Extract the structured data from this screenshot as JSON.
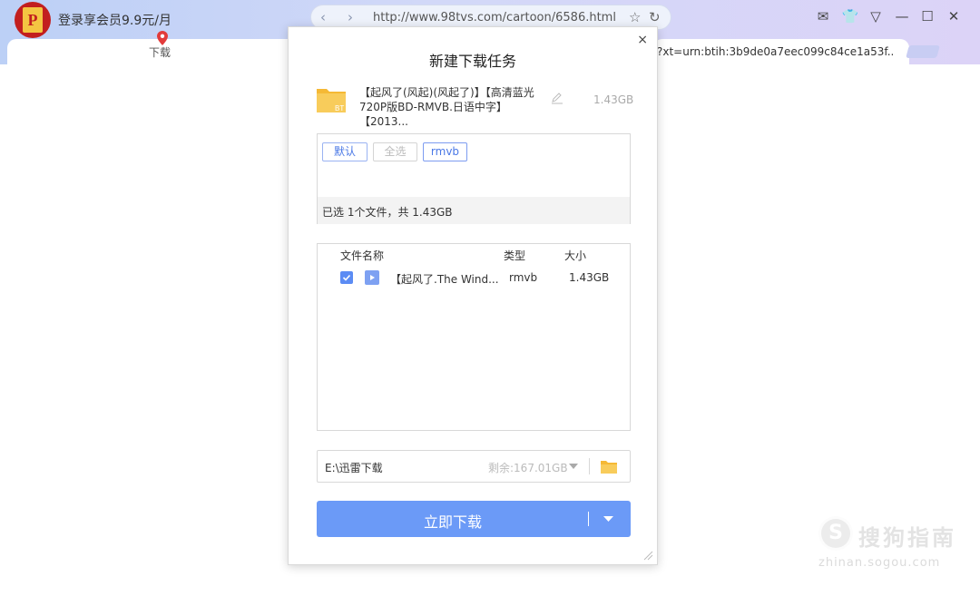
{
  "browser": {
    "vip_promo": "登录享会员9.9元/月",
    "tab_left_label": "下载",
    "url": "http://www.98tvs.com/cartoon/6586.html",
    "tab_right_label": "?xt=urn:btih:3b9de0a7eec099c84ce1a53f...",
    "nav_back": "‹",
    "nav_forward": "›",
    "star": "☆",
    "reload": "↻",
    "win_mail": "✉",
    "win_skin": "👕",
    "win_menu": "▽",
    "win_min": "—",
    "win_max": "☐",
    "win_close": "✕"
  },
  "dialog": {
    "title": "新建下载任务",
    "close": "×",
    "task_name": "【起风了(风起)(风起了)】【高清蓝光720P版BD-RMVB.日语中字】【2013...",
    "task_size": "1.43GB",
    "folder_badge": "BT",
    "filters": {
      "default": "默认",
      "select_all": "全选",
      "rmvb": "rmvb"
    },
    "selection_summary": "已选 1个文件，共 1.43GB",
    "table": {
      "headers": [
        "文件名称",
        "类型",
        "大小"
      ],
      "rows": [
        {
          "name": "【起风了.The Wind...",
          "type": "rmvb",
          "size": "1.43GB",
          "checked": true
        }
      ]
    },
    "save_path": "E:\\迅雷下载",
    "free_space": "剩余:167.01GB",
    "download_button": "立即下载"
  },
  "watermark": {
    "logo_letter": "S",
    "text": "搜狗指南",
    "url": "zhinan.sogou.com"
  },
  "colors": {
    "accent": "#6b9af7",
    "chip_blue": "#4a78e6",
    "folder_yellow": "#f7c64a"
  }
}
